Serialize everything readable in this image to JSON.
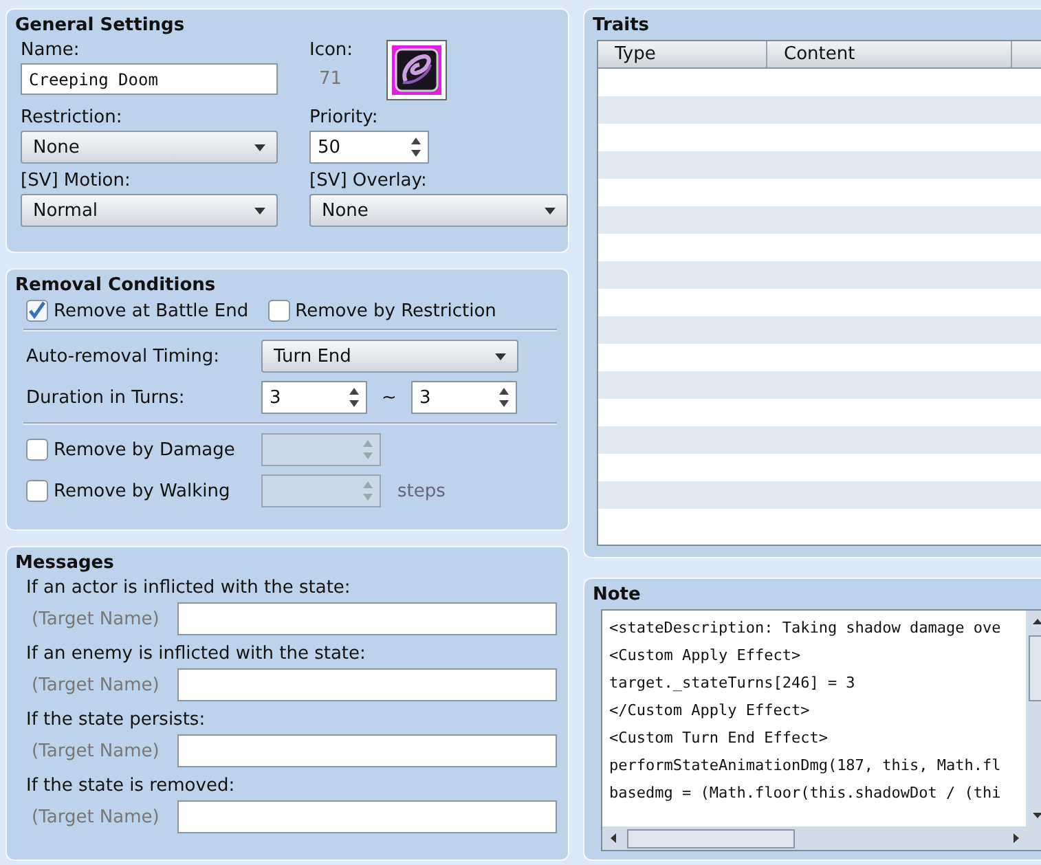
{
  "general_settings": {
    "title": "General Settings",
    "name": {
      "label": "Name:",
      "value": "Creeping Doom"
    },
    "icon": {
      "label": "Icon:",
      "index": "71"
    },
    "restriction": {
      "label": "Restriction:",
      "value": "None"
    },
    "priority": {
      "label": "Priority:",
      "value": "50"
    },
    "sv_motion": {
      "label": "[SV] Motion:",
      "value": "Normal"
    },
    "sv_overlay": {
      "label": "[SV] Overlay:",
      "value": "None"
    }
  },
  "removal_conditions": {
    "title": "Removal Conditions",
    "checkboxes": [
      {
        "label": "Remove at Battle End",
        "checked": true
      },
      {
        "label": "Remove by Restriction",
        "checked": false
      }
    ],
    "timing": {
      "label": "Auto-removal Timing:",
      "value": "Turn End"
    },
    "duration": {
      "label": "Duration in Turns:",
      "min": "3",
      "separator": "~",
      "max": "3"
    },
    "limit_rows": [
      {
        "label": "Remove by Damage",
        "checked": false,
        "disabled": true
      },
      {
        "label": "Remove by Walking",
        "checked": false,
        "disabled": true,
        "unit": "steps"
      }
    ]
  },
  "messages": {
    "title": "Messages",
    "items": [
      {
        "label": "If an actor is inflicted with the state:",
        "placeholder": "(Target Name)"
      },
      {
        "label": "If an enemy is inflicted with the state:",
        "placeholder": "(Target Name)"
      },
      {
        "label": "If the state persists:",
        "placeholder": "(Target Name)"
      },
      {
        "label": "If the state is removed:",
        "placeholder": "(Target Name)"
      }
    ]
  },
  "traits": {
    "title": "Traits",
    "columns": [
      "Type",
      "Content"
    ]
  },
  "note": {
    "title": "Note",
    "lines": [
      "<stateDescription: Taking shadow damage ove",
      "<Custom Apply Effect>",
      "target._stateTurns[246] = 3",
      "</Custom Apply Effect>",
      "<Custom Turn End Effect>",
      "performStateAnimationDmg(187, this, Math.fl",
      "basedmg = (Math.floor(this.shadowDot / (thi"
    ]
  }
}
